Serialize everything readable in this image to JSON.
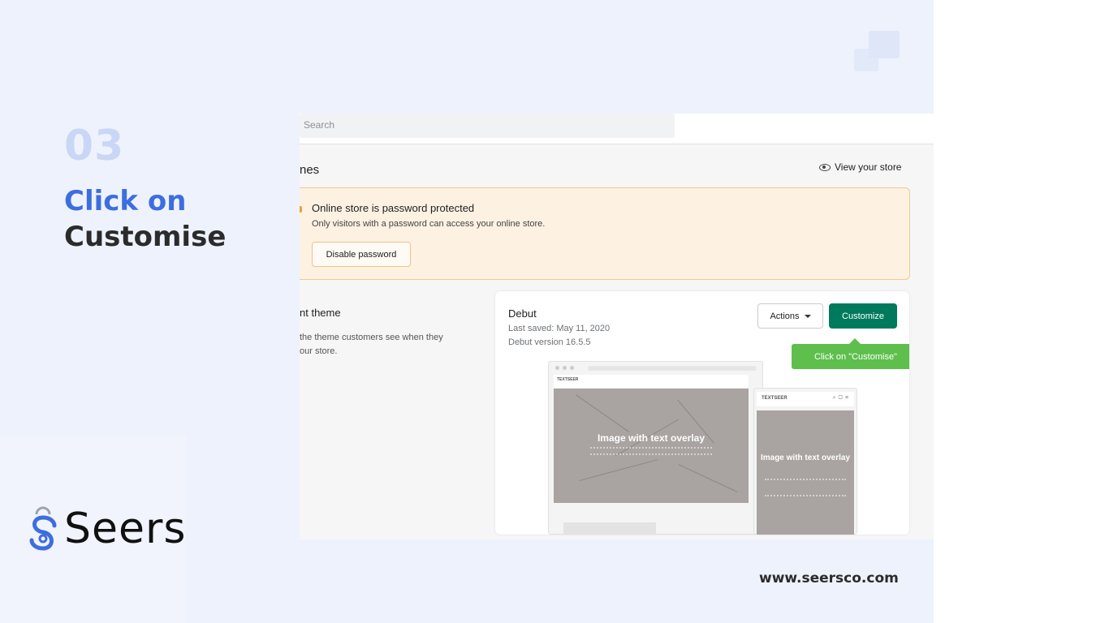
{
  "slide": {
    "step_number": "03",
    "title_line1": "Click on",
    "title_line2": "Customise",
    "logo_text": "Seers",
    "website": "www.seersco.com",
    "accent_color": "#3d6ee0"
  },
  "topbar": {
    "search_placeholder": "Search"
  },
  "themes": {
    "heading": "nes",
    "view_store_label": "View your store"
  },
  "banner": {
    "title": "Online store is password protected",
    "description": "Only visitors with a password can access your online store.",
    "button_label": "Disable password"
  },
  "current_theme": {
    "heading": "nt theme",
    "desc_line1": "the theme customers see when they",
    "desc_line2": "our store."
  },
  "theme_card": {
    "name": "Debut",
    "last_saved": "Last saved: May 11, 2020",
    "version": "Debut version 16.5.5",
    "actions_label": "Actions",
    "customize_label": "Customize",
    "customize_color": "#007a5c",
    "tooltip": "Click on \"Customise\""
  },
  "preview": {
    "desktop_brand": "TEXTSEER",
    "desktop_hero_title": "Image with text overlay",
    "mobile_brand": "TEXTSEER",
    "mobile_hero_title": "Image with text overlay"
  }
}
